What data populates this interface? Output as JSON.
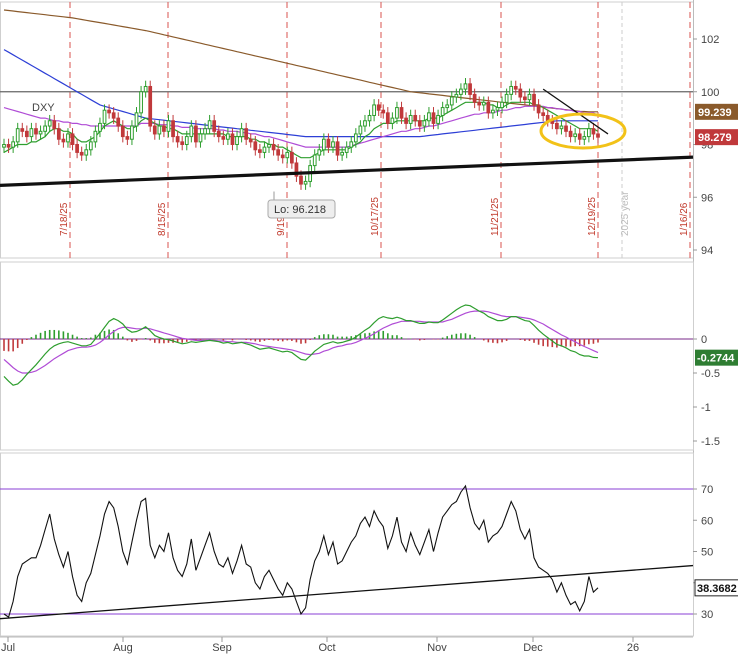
{
  "chart_data": [
    {
      "type": "candlestick",
      "symbol": "DXY",
      "y_axis_ticks": [
        94,
        96,
        98,
        100,
        102
      ],
      "ylim": [
        93.6,
        103.2
      ],
      "x_month_labels": [
        "Jul",
        "Aug",
        "Sep",
        "Oct",
        "Nov",
        "Dec",
        "26"
      ],
      "marker_dates": [
        "7/18/25",
        "8/15/25",
        "9/19/25",
        "10/17/25",
        "11/21/25",
        "12/19/25",
        "1/16/26"
      ],
      "year_marker": "2025 year",
      "low_annotation": "Lo: 96.218",
      "price_tags": [
        {
          "label": "99.239",
          "value": 99.239,
          "color": "#8a5a2b"
        },
        {
          "label": "98.279",
          "value": 98.279,
          "color": "#c0393b"
        }
      ],
      "horizontal_level": 100.0,
      "close_series": [
        98.0,
        97.9,
        98.1,
        98.6,
        98.5,
        98.3,
        98.6,
        98.4,
        98.5,
        98.7,
        98.9,
        98.6,
        98.2,
        98.1,
        98.4,
        98.0,
        97.7,
        97.6,
        97.8,
        98.1,
        98.5,
        98.8,
        99.3,
        99.2,
        99.0,
        98.7,
        98.3,
        98.2,
        98.7,
        99.2,
        100.0,
        100.2,
        98.7,
        98.4,
        98.7,
        98.5,
        98.9,
        98.3,
        98.1,
        98.0,
        98.3,
        98.7,
        98.1,
        98.4,
        98.6,
        98.9,
        98.5,
        98.3,
        98.2,
        98.4,
        98.0,
        98.3,
        98.6,
        98.2,
        98.1,
        97.8,
        97.7,
        97.9,
        98.0,
        97.8,
        97.6,
        97.5,
        97.7,
        97.3,
        96.8,
        96.5,
        96.6,
        97.2,
        97.6,
        97.8,
        98.2,
        97.9,
        98.1,
        97.6,
        97.7,
        97.9,
        98.1,
        98.4,
        98.7,
        98.9,
        99.1,
        99.5,
        99.3,
        99.2,
        98.8,
        99.0,
        99.4,
        99.0,
        98.8,
        99.1,
        98.9,
        98.7,
        98.9,
        99.2,
        98.8,
        99.1,
        99.4,
        99.5,
        99.8,
        99.9,
        100.1,
        100.3,
        99.9,
        99.6,
        99.5,
        99.6,
        99.2,
        99.3,
        99.4,
        99.6,
        99.9,
        100.2,
        100.1,
        99.8,
        99.7,
        99.9,
        99.5,
        99.2,
        99.1,
        98.9,
        98.8,
        98.6,
        98.7,
        98.5,
        98.3,
        98.4,
        98.2,
        98.3,
        98.6,
        98.4,
        98.279
      ],
      "ema_short": [
        97.7,
        97.8,
        97.9,
        98.0,
        98.0,
        98.0,
        98.1,
        98.1,
        98.2,
        98.3,
        98.5,
        98.6,
        98.6,
        98.5,
        98.5,
        98.4,
        98.2,
        98.1,
        98.1,
        98.2,
        98.3,
        98.5,
        98.7,
        98.8,
        98.9,
        98.8,
        98.7,
        98.6,
        98.6,
        98.7,
        98.9,
        99.0,
        98.9,
        98.8,
        98.7,
        98.7,
        98.6,
        98.6,
        98.5,
        98.4,
        98.4,
        98.4,
        98.4,
        98.4,
        98.4,
        98.4,
        98.4,
        98.4,
        98.4,
        98.3,
        98.3,
        98.3,
        98.3,
        98.3,
        98.2,
        98.2,
        98.1,
        98.1,
        98.0,
        98.0,
        97.9,
        97.9,
        97.8,
        97.7,
        97.6,
        97.5,
        97.5,
        97.5,
        97.6,
        97.7,
        97.8,
        97.8,
        97.8,
        97.8,
        97.8,
        97.8,
        97.9,
        98.0,
        98.1,
        98.3,
        98.4,
        98.6,
        98.7,
        98.8,
        98.8,
        98.8,
        98.9,
        98.9,
        98.9,
        98.9,
        98.9,
        98.9,
        98.9,
        99.0,
        99.0,
        99.0,
        99.1,
        99.2,
        99.3,
        99.4,
        99.5,
        99.6,
        99.6,
        99.6,
        99.6,
        99.6,
        99.5,
        99.5,
        99.4,
        99.4,
        99.5,
        99.6,
        99.6,
        99.6,
        99.6,
        99.6,
        99.5,
        99.5,
        99.4,
        99.3,
        99.2,
        99.1,
        99.0,
        98.9,
        98.8,
        98.7,
        98.6,
        98.6,
        98.6,
        98.6,
        98.5
      ],
      "ema_mid": [
        99.4,
        99.35,
        99.3,
        99.25,
        99.2,
        99.15,
        99.1,
        99.05,
        99.0,
        99.0,
        98.95,
        98.9,
        98.9,
        98.85,
        98.85,
        98.8,
        98.8,
        98.75,
        98.75,
        98.7,
        98.7,
        98.7,
        98.7,
        98.7,
        98.7,
        98.7,
        98.7,
        98.7,
        98.7,
        98.7,
        98.8,
        98.8,
        98.8,
        98.8,
        98.75,
        98.75,
        98.75,
        98.7,
        98.7,
        98.65,
        98.65,
        98.65,
        98.6,
        98.6,
        98.6,
        98.6,
        98.6,
        98.55,
        98.55,
        98.5,
        98.5,
        98.5,
        98.45,
        98.45,
        98.4,
        98.4,
        98.35,
        98.3,
        98.3,
        98.25,
        98.2,
        98.15,
        98.1,
        98.05,
        98.0,
        97.95,
        97.9,
        97.9,
        97.9,
        97.9,
        97.9,
        97.9,
        97.9,
        97.9,
        97.9,
        97.9,
        97.95,
        98.0,
        98.05,
        98.1,
        98.15,
        98.2,
        98.25,
        98.3,
        98.35,
        98.4,
        98.45,
        98.5,
        98.5,
        98.55,
        98.6,
        98.6,
        98.65,
        98.7,
        98.7,
        98.75,
        98.8,
        98.85,
        98.9,
        98.95,
        99.0,
        99.05,
        99.1,
        99.15,
        99.15,
        99.2,
        99.2,
        99.2,
        99.25,
        99.3,
        99.3,
        99.35,
        99.4,
        99.4,
        99.45,
        99.45,
        99.45,
        99.45,
        99.45,
        99.4,
        99.4,
        99.35,
        99.35,
        99.3,
        99.3,
        99.25,
        99.25,
        99.2,
        99.2,
        99.2,
        99.1
      ],
      "sma_long_blue": [
        101.6,
        101.5,
        101.4,
        101.3,
        101.2,
        101.1,
        101.0,
        100.9,
        100.8,
        100.7,
        100.6,
        100.5,
        100.4,
        100.3,
        100.2,
        100.1,
        100.0,
        99.9,
        99.8,
        99.7,
        99.6,
        99.5,
        99.45,
        99.4,
        99.35,
        99.3,
        99.25,
        99.2,
        99.15,
        99.1,
        99.05,
        99.0,
        98.98,
        98.96,
        98.94,
        98.92,
        98.9,
        98.88,
        98.86,
        98.84,
        98.82,
        98.8,
        98.78,
        98.76,
        98.74,
        98.72,
        98.7,
        98.68,
        98.66,
        98.64,
        98.62,
        98.6,
        98.58,
        98.56,
        98.54,
        98.52,
        98.5,
        98.48,
        98.46,
        98.44,
        98.42,
        98.4,
        98.38,
        98.36,
        98.34,
        98.32,
        98.3,
        98.3,
        98.3,
        98.3,
        98.3,
        98.3,
        98.3,
        98.3,
        98.3,
        98.3,
        98.3,
        98.3,
        98.3,
        98.3,
        98.3,
        98.3,
        98.3,
        98.3,
        98.3,
        98.3,
        98.3,
        98.3,
        98.3,
        98.3,
        98.3,
        98.3,
        98.32,
        98.34,
        98.36,
        98.38,
        98.4,
        98.42,
        98.44,
        98.46,
        98.48,
        98.5,
        98.52,
        98.54,
        98.56,
        98.58,
        98.6,
        98.62,
        98.64,
        98.66,
        98.68,
        98.7,
        98.72,
        98.74,
        98.76,
        98.78,
        98.8,
        98.82,
        98.84,
        98.86,
        98.88,
        98.9,
        98.9,
        98.9,
        98.9,
        98.9,
        98.9,
        98.9,
        98.9,
        98.9,
        98.9
      ],
      "sma_long_brown": [
        103.1,
        103.08,
        103.06,
        103.04,
        103.02,
        103.0,
        102.98,
        102.96,
        102.94,
        102.92,
        102.9,
        102.88,
        102.86,
        102.84,
        102.82,
        102.8,
        102.77,
        102.74,
        102.71,
        102.68,
        102.65,
        102.62,
        102.59,
        102.56,
        102.53,
        102.5,
        102.47,
        102.44,
        102.41,
        102.38,
        102.35,
        102.32,
        102.28,
        102.24,
        102.2,
        102.16,
        102.12,
        102.08,
        102.04,
        102.0,
        101.96,
        101.92,
        101.88,
        101.84,
        101.8,
        101.76,
        101.72,
        101.68,
        101.64,
        101.6,
        101.56,
        101.52,
        101.48,
        101.44,
        101.4,
        101.36,
        101.32,
        101.28,
        101.24,
        101.2,
        101.16,
        101.12,
        101.08,
        101.04,
        101.0,
        100.96,
        100.92,
        100.88,
        100.84,
        100.8,
        100.76,
        100.72,
        100.68,
        100.64,
        100.6,
        100.56,
        100.52,
        100.48,
        100.44,
        100.4,
        100.36,
        100.32,
        100.28,
        100.24,
        100.2,
        100.16,
        100.12,
        100.08,
        100.04,
        100.0,
        99.98,
        99.96,
        99.94,
        99.92,
        99.9,
        99.88,
        99.86,
        99.84,
        99.82,
        99.8,
        99.78,
        99.76,
        99.74,
        99.72,
        99.7,
        99.68,
        99.66,
        99.64,
        99.62,
        99.6,
        99.58,
        99.56,
        99.54,
        99.52,
        99.5,
        99.48,
        99.46,
        99.44,
        99.42,
        99.4,
        99.38,
        99.36,
        99.34,
        99.32,
        99.3,
        99.28,
        99.26,
        99.25,
        99.24,
        99.24,
        99.239
      ]
    },
    {
      "type": "line",
      "indicator": "MACD",
      "y_axis_ticks": [
        0,
        -0.5,
        -1,
        -1.5
      ],
      "ylim": [
        -1.6,
        0.85
      ],
      "value_tag": {
        "label": "-0.2744",
        "value": -0.2744,
        "color": "#2e7d32"
      },
      "macd_series": [
        -0.55,
        -0.62,
        -0.68,
        -0.66,
        -0.6,
        -0.52,
        -0.45,
        -0.38,
        -0.3,
        -0.22,
        -0.15,
        -0.1,
        -0.07,
        -0.05,
        -0.04,
        -0.06,
        -0.08,
        -0.1,
        -0.1,
        -0.08,
        0.0,
        0.08,
        0.17,
        0.26,
        0.3,
        0.27,
        0.22,
        0.14,
        0.1,
        0.11,
        0.14,
        0.18,
        0.12,
        0.05,
        0.02,
        0.0,
        -0.01,
        -0.03,
        -0.05,
        -0.07,
        -0.06,
        -0.04,
        -0.05,
        -0.04,
        -0.03,
        -0.02,
        -0.03,
        -0.04,
        -0.06,
        -0.05,
        -0.07,
        -0.06,
        -0.05,
        -0.07,
        -0.09,
        -0.12,
        -0.15,
        -0.14,
        -0.13,
        -0.15,
        -0.17,
        -0.19,
        -0.18,
        -0.2,
        -0.25,
        -0.3,
        -0.31,
        -0.25,
        -0.18,
        -0.13,
        -0.08,
        -0.06,
        -0.04,
        -0.06,
        -0.05,
        -0.03,
        -0.01,
        0.03,
        0.08,
        0.13,
        0.17,
        0.24,
        0.3,
        0.33,
        0.31,
        0.3,
        0.32,
        0.3,
        0.27,
        0.27,
        0.25,
        0.23,
        0.23,
        0.25,
        0.24,
        0.24,
        0.28,
        0.33,
        0.38,
        0.43,
        0.47,
        0.5,
        0.49,
        0.45,
        0.41,
        0.38,
        0.33,
        0.3,
        0.27,
        0.27,
        0.29,
        0.33,
        0.33,
        0.3,
        0.27,
        0.26,
        0.2,
        0.13,
        0.07,
        0.02,
        -0.03,
        -0.08,
        -0.1,
        -0.13,
        -0.17,
        -0.19,
        -0.23,
        -0.25,
        -0.25,
        -0.27,
        -0.2744
      ],
      "signal_series": [
        -0.3,
        -0.36,
        -0.42,
        -0.47,
        -0.5,
        -0.5,
        -0.49,
        -0.47,
        -0.43,
        -0.39,
        -0.34,
        -0.29,
        -0.25,
        -0.21,
        -0.17,
        -0.15,
        -0.13,
        -0.12,
        -0.12,
        -0.11,
        -0.09,
        -0.05,
        0.0,
        0.06,
        0.11,
        0.15,
        0.17,
        0.17,
        0.16,
        0.15,
        0.15,
        0.16,
        0.15,
        0.13,
        0.11,
        0.09,
        0.07,
        0.05,
        0.03,
        0.01,
        0.0,
        -0.01,
        -0.02,
        -0.02,
        -0.02,
        -0.02,
        -0.02,
        -0.03,
        -0.03,
        -0.04,
        -0.04,
        -0.05,
        -0.05,
        -0.05,
        -0.06,
        -0.07,
        -0.09,
        -0.1,
        -0.11,
        -0.12,
        -0.13,
        -0.14,
        -0.15,
        -0.16,
        -0.18,
        -0.2,
        -0.22,
        -0.23,
        -0.22,
        -0.21,
        -0.18,
        -0.16,
        -0.13,
        -0.11,
        -0.1,
        -0.08,
        -0.07,
        -0.05,
        -0.02,
        0.01,
        0.04,
        0.08,
        0.12,
        0.16,
        0.19,
        0.22,
        0.24,
        0.26,
        0.26,
        0.26,
        0.26,
        0.26,
        0.25,
        0.25,
        0.25,
        0.25,
        0.25,
        0.27,
        0.29,
        0.32,
        0.35,
        0.38,
        0.4,
        0.41,
        0.41,
        0.41,
        0.4,
        0.38,
        0.36,
        0.34,
        0.33,
        0.33,
        0.33,
        0.32,
        0.31,
        0.3,
        0.28,
        0.25,
        0.22,
        0.18,
        0.14,
        0.1,
        0.06,
        0.03,
        -0.01,
        -0.04,
        -0.08,
        -0.11,
        -0.14,
        -0.17,
        -0.2
      ]
    },
    {
      "type": "line",
      "indicator": "RSI",
      "y_axis_ticks": [
        30,
        40,
        50,
        60,
        70
      ],
      "ylim": [
        24.5,
        74
      ],
      "levels": [
        70,
        30
      ],
      "value_tag": {
        "label": "38.3682",
        "value": 38.3682,
        "color": "#222222"
      },
      "rsi_series": [
        30,
        29,
        34,
        42,
        46,
        47,
        48,
        48,
        52,
        57,
        62,
        54,
        49,
        45,
        50,
        42,
        36,
        34,
        40,
        43,
        49,
        55,
        62,
        66,
        64,
        58,
        50,
        46,
        53,
        60,
        66,
        67,
        52,
        48,
        52,
        50,
        56,
        48,
        44,
        42,
        46,
        54,
        44,
        48,
        52,
        56,
        50,
        46,
        45,
        48,
        43,
        47,
        52,
        46,
        45,
        40,
        38,
        42,
        44,
        41,
        38,
        36,
        40,
        38,
        34,
        30,
        32,
        41,
        47,
        50,
        55,
        49,
        53,
        46,
        47,
        50,
        53,
        55,
        59,
        61,
        58,
        63,
        60,
        58,
        51,
        55,
        61,
        53,
        50,
        56,
        52,
        49,
        53,
        57,
        50,
        56,
        61,
        63,
        65,
        66,
        69,
        71,
        64,
        59,
        57,
        60,
        53,
        55,
        56,
        58,
        62,
        66,
        63,
        57,
        54,
        57,
        48,
        45,
        44,
        43,
        41,
        37,
        40,
        36,
        33,
        34,
        31,
        34,
        42,
        37,
        38.3682
      ],
      "trendline": {
        "start": 28.5,
        "end": 45.5
      }
    }
  ]
}
